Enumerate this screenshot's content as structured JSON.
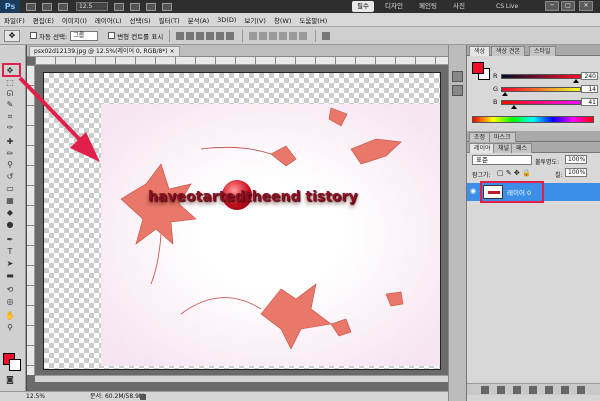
{
  "appbar": {
    "logo": "Ps",
    "zoom": "12.5",
    "workspaces": [
      "필수",
      "디자인",
      "페인팅",
      "사진"
    ],
    "active_workspace": "필수",
    "cs_live": "CS Live",
    "min": "─",
    "max": "□",
    "close": "✕"
  },
  "menu": [
    "파일(F)",
    "편집(E)",
    "이미지(I)",
    "레이어(L)",
    "선택(S)",
    "필터(T)",
    "분석(A)",
    "3D(D)",
    "보기(V)",
    "창(W)",
    "도움말(H)"
  ],
  "options": {
    "auto_select": "자동 선택:",
    "auto_select_value": "그룹",
    "transform_controls": "변형 컨트롤 표시"
  },
  "document": {
    "tab_title": "psx02d12139.jpg @ 12.5%(레이어 0, RGB/8*)",
    "tab_close": "×",
    "photo_text": "haveotartedtheend tistory"
  },
  "status": {
    "zoom": "12.5%",
    "doc_info": "문서: 60.2M/58.9M"
  },
  "color_panel": {
    "tabs": [
      "색상",
      "색상 견본",
      "스타일"
    ],
    "fg_color": "#f00e29",
    "channels": [
      {
        "letter": "R",
        "value": "240",
        "gradient": "linear-gradient(90deg,#000e29,#ff0e29)",
        "fraction": 0.94
      },
      {
        "letter": "G",
        "value": "14",
        "gradient": "linear-gradient(90deg,#f00029,#f0ff29)",
        "fraction": 0.055
      },
      {
        "letter": "B",
        "value": "41",
        "gradient": "linear-gradient(90deg,#f00e00,#f00eff)",
        "fraction": 0.16
      }
    ]
  },
  "adjust_panel": {
    "tabs": [
      "조정",
      "마스크"
    ]
  },
  "layers_panel": {
    "tabs": [
      "레이어",
      "채널",
      "패스"
    ],
    "blend_mode": "표준",
    "opacity_label": "불투명도:",
    "opacity_value": "100%",
    "lock_label": "잠그기:",
    "fill_label": "칠:",
    "fill_value": "100%",
    "layer_name": "레이어 0"
  }
}
